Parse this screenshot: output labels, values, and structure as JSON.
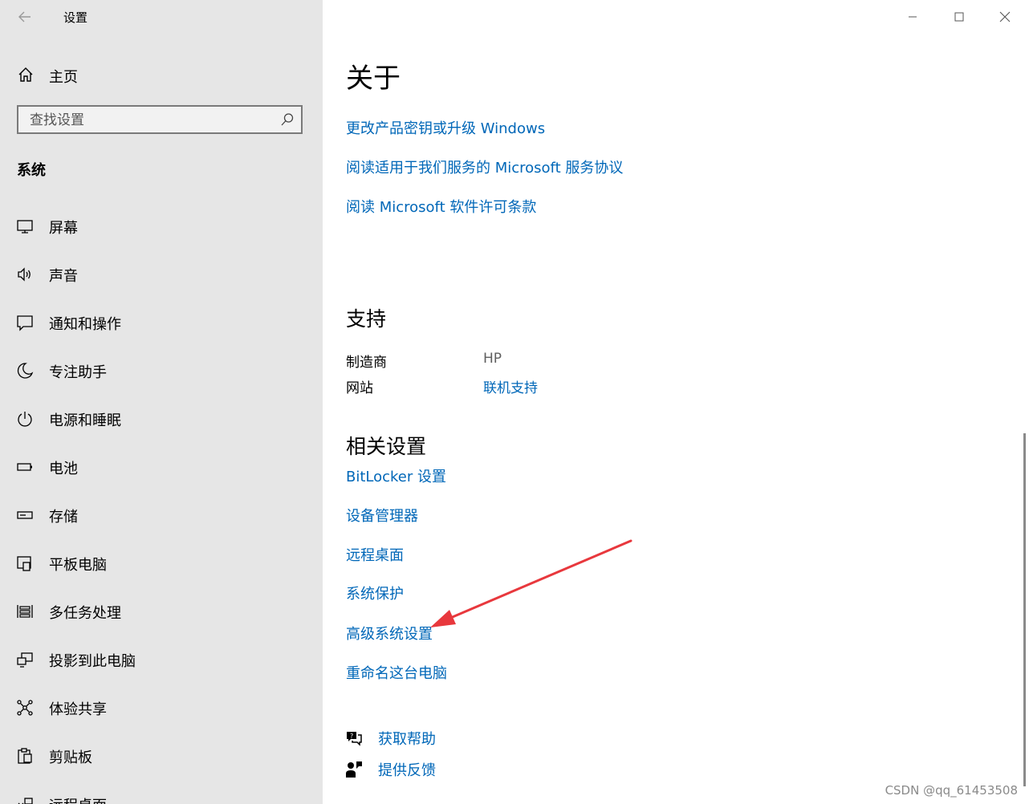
{
  "window": {
    "title": "设置",
    "controls": {
      "minimize": "minimize",
      "maximize": "maximize",
      "close": "close"
    }
  },
  "sidebar": {
    "home_label": "主页",
    "search_placeholder": "查找设置",
    "section_title": "系统",
    "items": [
      {
        "label": "屏幕",
        "icon": "display-icon"
      },
      {
        "label": "声音",
        "icon": "speaker-icon"
      },
      {
        "label": "通知和操作",
        "icon": "notification-icon"
      },
      {
        "label": "专注助手",
        "icon": "moon-icon"
      },
      {
        "label": "电源和睡眠",
        "icon": "power-icon"
      },
      {
        "label": "电池",
        "icon": "battery-icon"
      },
      {
        "label": "存储",
        "icon": "storage-icon"
      },
      {
        "label": "平板电脑",
        "icon": "tablet-icon"
      },
      {
        "label": "多任务处理",
        "icon": "multitask-icon"
      },
      {
        "label": "投影到此电脑",
        "icon": "project-icon"
      },
      {
        "label": "体验共享",
        "icon": "share-icon"
      },
      {
        "label": "剪贴板",
        "icon": "clipboard-icon"
      },
      {
        "label": "远程桌面",
        "icon": "remote-desktop-icon"
      }
    ]
  },
  "main": {
    "about_title": "关于",
    "about_links": [
      "更改产品密钥或升级 Windows",
      "阅读适用于我们服务的 Microsoft 服务协议",
      "阅读 Microsoft 软件许可条款"
    ],
    "support_title": "支持",
    "support": {
      "manufacturer_key": "制造商",
      "manufacturer_value": "HP",
      "website_key": "网站",
      "website_value": "联机支持"
    },
    "related_title": "相关设置",
    "related_links": [
      "BitLocker 设置",
      "设备管理器",
      "远程桌面",
      "系统保护",
      "高级系统设置",
      "重命名这台电脑"
    ],
    "help": {
      "get_help": "获取帮助",
      "feedback": "提供反馈"
    }
  },
  "annotation": {
    "arrow_color": "#e8383d"
  },
  "watermark": "CSDN @qq_61453508",
  "colors": {
    "link": "#0067b8",
    "sidebar_bg": "#e6e6e6"
  }
}
